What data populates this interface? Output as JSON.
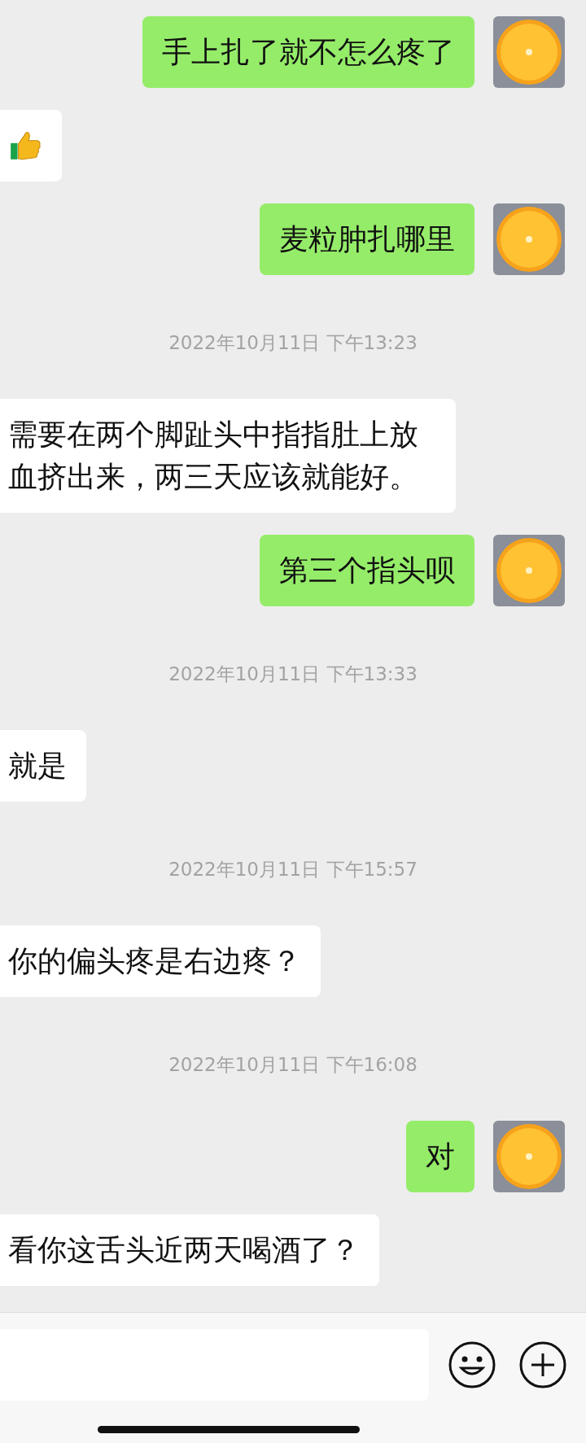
{
  "messages": [
    {
      "kind": "text",
      "outgoing": true,
      "text": "手上扎了就不怎么疼了"
    },
    {
      "kind": "sticker",
      "outgoing": false
    },
    {
      "kind": "text",
      "outgoing": true,
      "text": "麦粒肿扎哪里"
    },
    {
      "kind": "timestamp",
      "text": "2022年10月11日 下午13:23"
    },
    {
      "kind": "text",
      "outgoing": false,
      "text": "需要在两个脚趾头中指指肚上放血挤出来，两三天应该就能好。"
    },
    {
      "kind": "text",
      "outgoing": true,
      "text": "第三个指头呗"
    },
    {
      "kind": "timestamp",
      "text": "2022年10月11日 下午13:33"
    },
    {
      "kind": "text",
      "outgoing": false,
      "text": "就是"
    },
    {
      "kind": "timestamp",
      "text": "2022年10月11日 下午15:57"
    },
    {
      "kind": "text",
      "outgoing": false,
      "text": "你的偏头疼是右边疼？"
    },
    {
      "kind": "timestamp",
      "text": "2022年10月11日 下午16:08"
    },
    {
      "kind": "text",
      "outgoing": true,
      "text": "对"
    },
    {
      "kind": "text",
      "outgoing": false,
      "text": "看你这舌头近两天喝酒了？"
    }
  ]
}
